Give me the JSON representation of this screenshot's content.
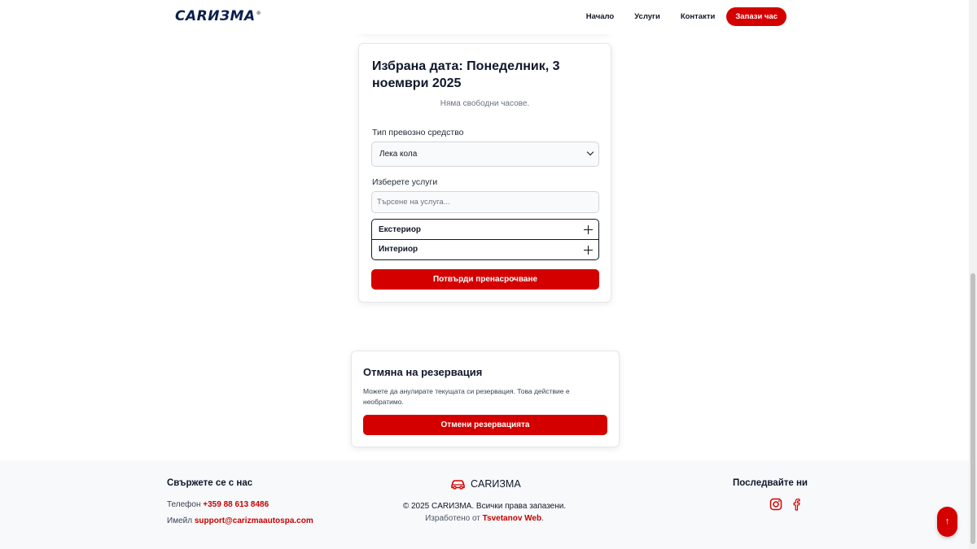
{
  "header": {
    "logo": "CARИЗМА",
    "logo_mark": "®",
    "nav": [
      "Начало",
      "Услуги",
      "Контакти"
    ],
    "cta": "Запази час"
  },
  "booking": {
    "title": "Избрана дата: Понеделник, 3 ноември 2025",
    "no_slots": "Няма свободни часове.",
    "vehicle_label": "Тип превозно средство",
    "vehicle_value": "Лека кола",
    "services_label": "Изберете услуги",
    "search_placeholder": "Търсене на услуга...",
    "categories": [
      "Екстериор",
      "Интериор"
    ],
    "confirm": "Потвърди пренасрочване"
  },
  "cancel": {
    "title": "Отмяна на резервация",
    "text": "Можете да анулирате текущата си резервация. Това действие е необратимо.",
    "button": "Отмени резервацията"
  },
  "footer": {
    "contact_title": "Свържете се с нас",
    "phone_label": "Телефон",
    "phone": "+359 88 613 8486",
    "email_label": "Имейл",
    "email": "support@carizmaautospa.com",
    "brand": "CARИЗМА",
    "copyright": "© 2025 CARИЗМА. Всички права запазени.",
    "made_by_prefix": "Изработено от",
    "made_by": "Tsvetanov Web",
    "made_by_suffix": ".",
    "follow_title": "Последвайте ни",
    "socials": [
      "instagram-icon",
      "facebook-icon"
    ]
  },
  "scroll_top": "↑",
  "colors": {
    "accent": "#d40000",
    "navy": "#0b1f4d"
  }
}
